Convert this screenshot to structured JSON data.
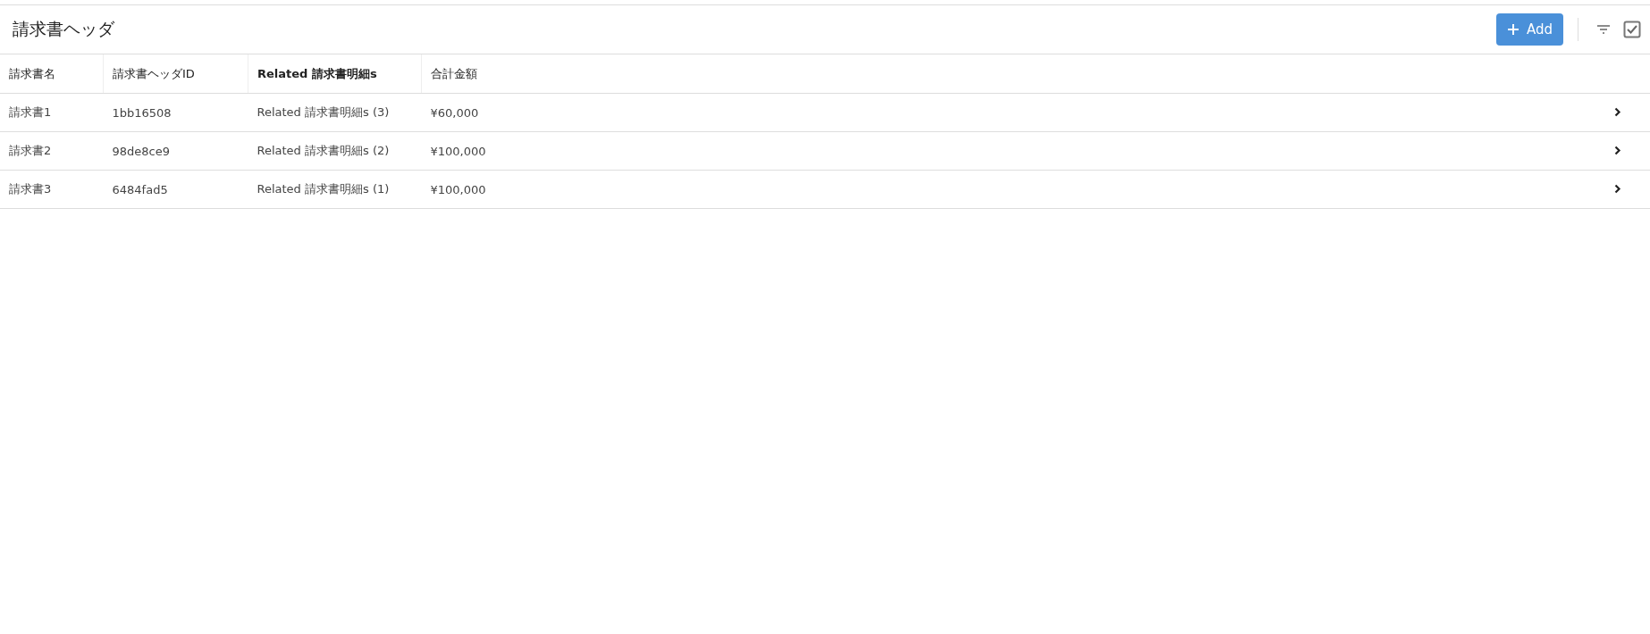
{
  "header": {
    "title": "請求書ヘッダ",
    "add_button": "Add"
  },
  "table": {
    "columns": [
      "請求書名",
      "請求書ヘッダID",
      "Related 請求書明細s",
      "合計金額"
    ],
    "rows": [
      {
        "cells": [
          "請求書1",
          "1bb16508",
          "Related 請求書明細s (3)",
          "¥60,000"
        ]
      },
      {
        "cells": [
          "請求書2",
          "98de8ce9",
          "Related 請求書明細s (2)",
          "¥100,000"
        ]
      },
      {
        "cells": [
          "請求書3",
          "6484fad5",
          "Related 請求書明細s (1)",
          "¥100,000"
        ]
      }
    ]
  }
}
